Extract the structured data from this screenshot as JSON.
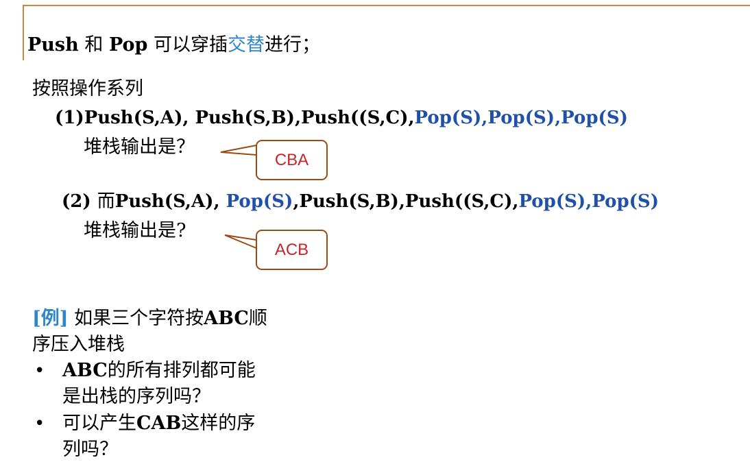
{
  "header": {
    "push": "Push",
    "and": " 和 ",
    "pop": "Pop",
    "text1": " 可以穿插",
    "link": "交替",
    "text2": "进行；"
  },
  "section": {
    "title": "按照操作系列"
  },
  "seq1": {
    "black": "(1)Push(S,A), Push(S,B),Push((S,C),",
    "blue": "Pop(S),Pop(S),Pop(S)",
    "question": "堆栈输出是？",
    "answer": "CBA"
  },
  "seq2": {
    "prefix": "(2) ",
    "er": "而",
    "push1": "Push(S,A), ",
    "pop1": "Pop(S)",
    "mid": ",Push(S,B),Push((S,C),",
    "pops": "Pop(S),Pop(S)",
    "question": "堆栈输出是?",
    "answer": "ACB"
  },
  "example": {
    "tag": "[例]",
    "line1a": " 如果三个字符按",
    "line1b": "ABC",
    "line1c": "顺",
    "line2": "序压入堆栈",
    "bullet_char": "•",
    "b1_l1a": "ABC",
    "b1_l1b": "的所有排列都可能",
    "b1_l2": "是出栈的序列吗？",
    "b2_l1a": "可以产生",
    "b2_l1b": "CAB",
    "b2_l1c": "这样的序",
    "b2_l2": "列吗？"
  }
}
